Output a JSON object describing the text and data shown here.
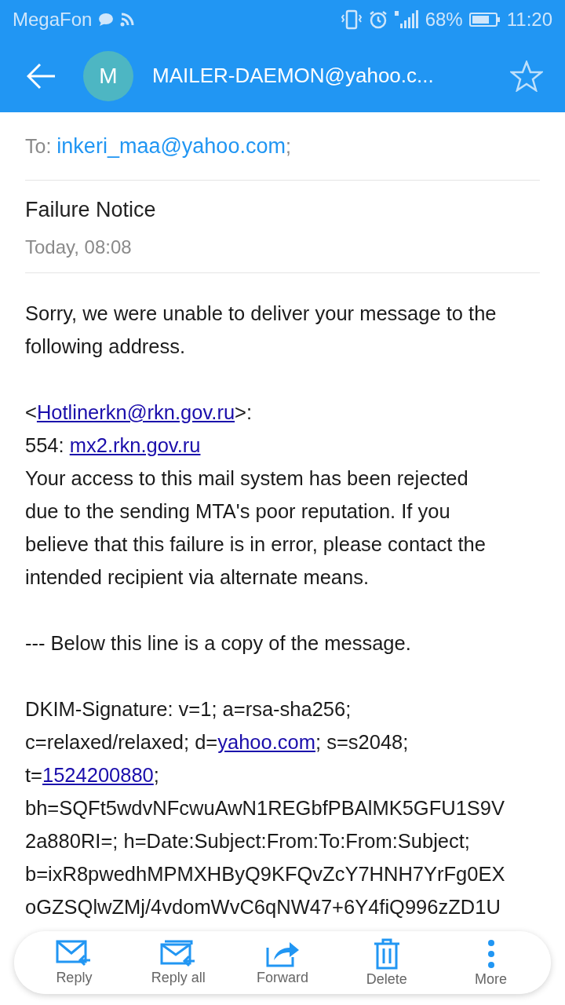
{
  "status_bar": {
    "carrier": "MegaFon",
    "battery": "68%",
    "time": "11:20"
  },
  "app_bar": {
    "avatar_letter": "M",
    "sender": "MAILER-DAEMON@yahoo.c...",
    "starred": false
  },
  "recipients": {
    "label": "To:",
    "address": "inkeri_maa@yahoo.com",
    "separator": ";"
  },
  "subject": "Failure Notice",
  "date": "Today, 08:08",
  "body": [
    [
      [
        {
          "text": "Sorry, we were unable to deliver your message to the",
          "link": false
        }
      ],
      [
        {
          "text": "following address.",
          "link": false
        }
      ]
    ],
    [
      [
        {
          "text": "<",
          "link": false
        },
        {
          "text": "Hotlinerkn@rkn.gov.ru",
          "link": true
        },
        {
          "text": ">:",
          "link": false
        }
      ],
      [
        {
          "text": "554: ",
          "link": false
        },
        {
          "text": "mx2.rkn.gov.ru",
          "link": true
        }
      ],
      [
        {
          "text": "Your access to this mail system has been rejected",
          "link": false
        }
      ],
      [
        {
          "text": "due to the sending MTA's poor reputation. If you",
          "link": false
        }
      ],
      [
        {
          "text": "believe that this failure is in error, please contact the",
          "link": false
        }
      ],
      [
        {
          "text": "intended recipient via alternate means.",
          "link": false
        }
      ]
    ],
    [
      [
        {
          "text": "--- Below this line is a copy of the message.",
          "link": false
        }
      ]
    ],
    [
      [
        {
          "text": "DKIM-Signature: v=1; a=rsa-sha256;",
          "link": false
        }
      ],
      [
        {
          "text": "c=relaxed/relaxed; d=",
          "link": false
        },
        {
          "text": "yahoo.com",
          "link": true
        },
        {
          "text": "; s=s2048;",
          "link": false
        }
      ],
      [
        {
          "text": "t=",
          "link": false
        },
        {
          "text": "1524200880",
          "link": true
        },
        {
          "text": ";",
          "link": false
        }
      ],
      [
        {
          "text": "bh=SQFt5wdvNFcwuAwN1REGbfPBAlMK5GFU1S9V",
          "link": false
        }
      ],
      [
        {
          "text": "2a880RI=; h=Date:Subject:From:To:From:Subject;",
          "link": false
        }
      ],
      [
        {
          "text": "b=ixR8pwedhMPMXHByQ9KFQvZcY7HNH7YrFg0EX",
          "link": false
        }
      ],
      [
        {
          "text": "oGZSQlwZMj/4vdomWvC6qNW47+6Y4fiQ996zZD1U",
          "link": false
        }
      ]
    ]
  ],
  "actions": [
    {
      "kind": "reply",
      "label": "Reply"
    },
    {
      "kind": "reply_all",
      "label": "Reply all"
    },
    {
      "kind": "forward",
      "label": "Forward"
    },
    {
      "kind": "delete",
      "label": "Delete"
    },
    {
      "kind": "more",
      "label": "More"
    }
  ]
}
